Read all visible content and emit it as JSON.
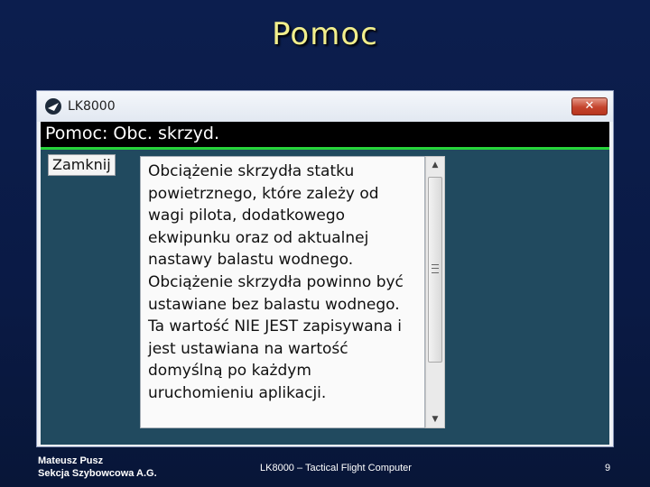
{
  "slide": {
    "title": "Pomoc",
    "footer_author": "Mateusz Pusz",
    "footer_org": "Sekcja Szybowcowa A.G.",
    "footer_center": "LK8000 – Tactical Flight Computer",
    "page_number": "9"
  },
  "window": {
    "app_name": "LK8000",
    "app_icon": "lk8000-logo-icon",
    "close_glyph": "✕"
  },
  "dialog": {
    "title": "Pomoc: Obc. skrzyd.",
    "close_button": "Zamknij",
    "help_text": "Obciążenie skrzydła statku powietrznego, które zależy od wagi pilota, dodatkowego ekwipunku oraz od aktualnej nastawy balastu wodnego.\nObciążenie skrzydła powinno być ustawiane bez balastu wodnego.\nTa wartość NIE JEST zapisywana i jest ustawiana na wartość domyślną po każdym uruchomieniu aplikacji.",
    "scroll_up_glyph": "▲",
    "scroll_down_glyph": "▼"
  },
  "colors": {
    "slide_background": "#0c1e4e",
    "title_color": "#f2ef8c",
    "app_background": "#214a5f",
    "header_accent": "#27d43a",
    "close_button": "#c4442d"
  }
}
